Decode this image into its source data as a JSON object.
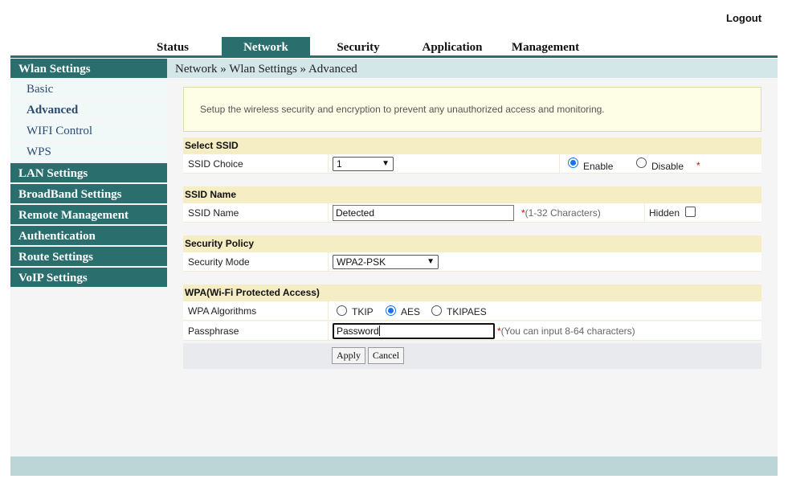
{
  "header": {
    "logout": "Logout"
  },
  "nav": {
    "tabs": [
      "Status",
      "Network",
      "Security",
      "Application",
      "Management"
    ]
  },
  "sidebar": {
    "wlan": "Wlan Settings",
    "subs": [
      "Basic",
      "Advanced",
      "WIFI Control",
      "WPS"
    ],
    "sections": [
      "LAN Settings",
      "BroadBand Settings",
      "Remote Management",
      "Authentication",
      "Route Settings",
      "VoIP Settings"
    ]
  },
  "breadcrumb": "Network » Wlan Settings » Advanced",
  "notice": "Setup the wireless security and encryption to prevent any unauthorized access and monitoring.",
  "ssid_select": {
    "title": "Select SSID",
    "label": "SSID Choice",
    "value": "1",
    "enable": "Enable",
    "disable": "Disable",
    "required": "*"
  },
  "ssid_name": {
    "title": "SSID Name",
    "label": "SSID Name",
    "value": "Detected",
    "hint": "(1-32 Characters)",
    "required": "*",
    "hidden": "Hidden"
  },
  "security": {
    "title": "Security Policy",
    "label": "Security Mode",
    "value": "WPA2-PSK"
  },
  "wpa": {
    "title": "WPA(Wi-Fi Protected Access)",
    "alg_label": "WPA Algorithms",
    "options": [
      "TKIP",
      "AES",
      "TKIPAES"
    ],
    "pass_label": "Passphrase",
    "pass_value": "Password",
    "pass_hint": "(You can input 8-64 characters)",
    "required": "*"
  },
  "buttons": {
    "apply": "Apply",
    "cancel": "Cancel"
  },
  "colors": {
    "accent": "#2a6e6e",
    "breadcrumb_bg": "#d3e6e8",
    "section_bg": "#f5edc3",
    "notice_bg": "#fefee6",
    "radio": "#1a73e8",
    "required": "#dd0000"
  }
}
